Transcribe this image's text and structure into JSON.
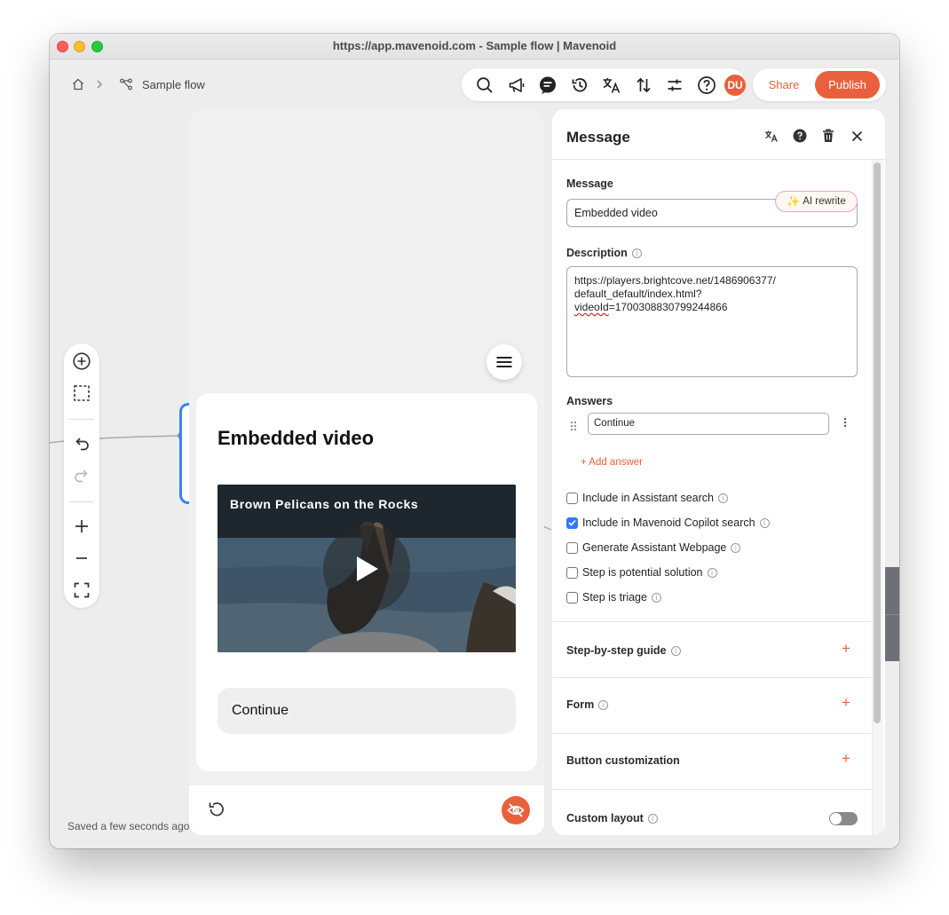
{
  "window": {
    "title": "https://app.mavenoid.com - Sample flow | Mavenoid"
  },
  "breadcrumb": {
    "flow_name": "Sample flow"
  },
  "toolbar": {
    "icons": [
      "search-icon",
      "announce-icon",
      "chat-icon",
      "history-icon",
      "translate-icon",
      "sort-icon",
      "settings-icon",
      "help-icon"
    ],
    "avatar_initials": "DU",
    "share_label": "Share",
    "publish_label": "Publish"
  },
  "canvas": {
    "saved_status": "Saved a few seconds ago"
  },
  "preview": {
    "card_title": "Embedded video",
    "video_title": "Brown Pelicans on the Rocks",
    "continue_label": "Continue"
  },
  "panel": {
    "title": "Message",
    "message_label": "Message",
    "message_value": "Embedded video",
    "description_label": "Description",
    "ai_rewrite_label": "AI rewrite",
    "description_line1": "https://players.brightcove.net/1486906377/",
    "description_line2": "default_default/index.html?",
    "description_line3_a": "videoId",
    "description_line3_b": "=1700308830799244866",
    "answers_label": "Answers",
    "answer_value": "Continue",
    "add_answer_label": "+ Add answer",
    "checkboxes": [
      {
        "label": "Include in Assistant search",
        "checked": false
      },
      {
        "label": "Include in Mavenoid Copilot search",
        "checked": true
      },
      {
        "label": "Generate Assistant Webpage",
        "checked": false
      },
      {
        "label": "Step is potential solution",
        "checked": false
      },
      {
        "label": "Step is triage",
        "checked": false
      }
    ],
    "sections": [
      "Step-by-step guide",
      "Form",
      "Button customization"
    ],
    "custom_layout_label": "Custom layout",
    "custom_layout_on": false
  },
  "colors": {
    "accent": "#e8613c",
    "checkbox": "#3478f6",
    "selection": "#3b82f6"
  }
}
